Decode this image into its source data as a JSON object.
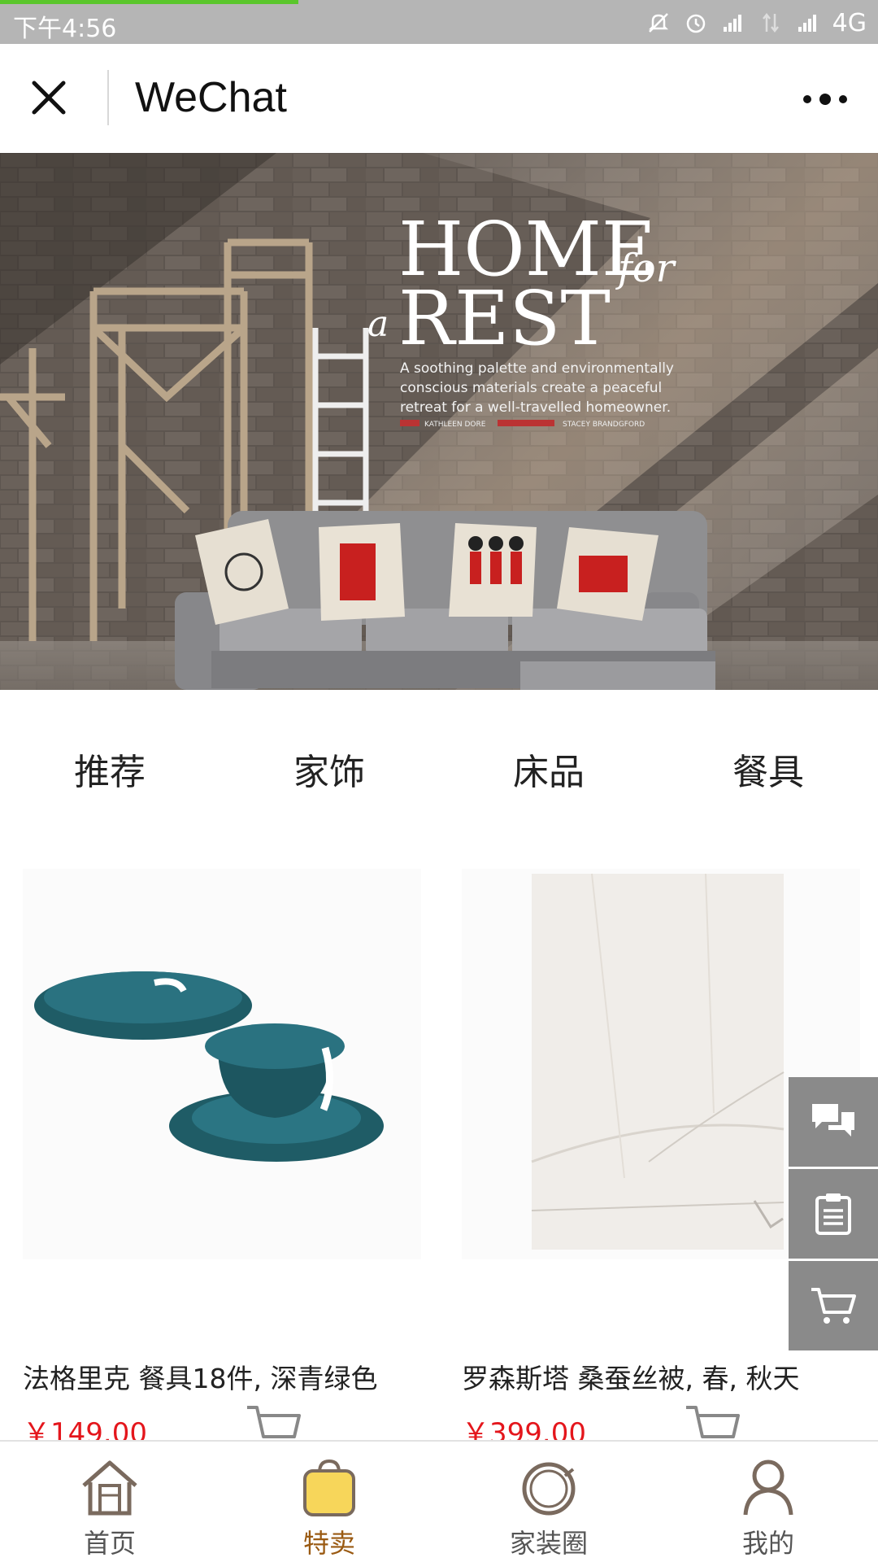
{
  "status_bar": {
    "time": "下午4:56",
    "network": "4G",
    "load_progress_pct": 34
  },
  "title_bar": {
    "title": "WeChat"
  },
  "hero": {
    "headline_line1": "HOME",
    "headline_for": "for",
    "headline_a": "a",
    "headline_line2": "REST",
    "body_line1": "A soothing palette and environmentally",
    "body_line2": "conscious materials create a peaceful",
    "body_line3": "retreat for a well-travelled homeowner.",
    "credit_left": "KATHLEEN DORE",
    "credit_right": "STACEY BRANDGFORD"
  },
  "categories": [
    {
      "label": "推荐"
    },
    {
      "label": "家饰"
    },
    {
      "label": "床品"
    },
    {
      "label": "餐具"
    }
  ],
  "products": [
    {
      "name": "法格里克 餐具18件, 深青绿色",
      "price": "￥149.00"
    },
    {
      "name": "罗森斯塔 桑蚕丝被, 春, 秋天",
      "price": "￥399.00"
    }
  ],
  "side_actions": {
    "chat": "chat-icon",
    "orders": "clipboard-icon",
    "cart": "cart-icon"
  },
  "bottom_nav": {
    "active_index": 1,
    "items": [
      {
        "label": "首页",
        "icon": "house-icon"
      },
      {
        "label": "特卖",
        "icon": "shopping-bag-icon"
      },
      {
        "label": "家装圈",
        "icon": "ring-icon"
      },
      {
        "label": "我的",
        "icon": "person-icon"
      }
    ]
  },
  "colors": {
    "status_bar": "#b5b5b5",
    "load_progress": "#5ac62c",
    "price": "#e4161c",
    "active_nav": "#9a5a12",
    "bag_fill": "#f7d65a",
    "side_button": "#8a8a8a",
    "plate_teal": "#1f5c66"
  }
}
